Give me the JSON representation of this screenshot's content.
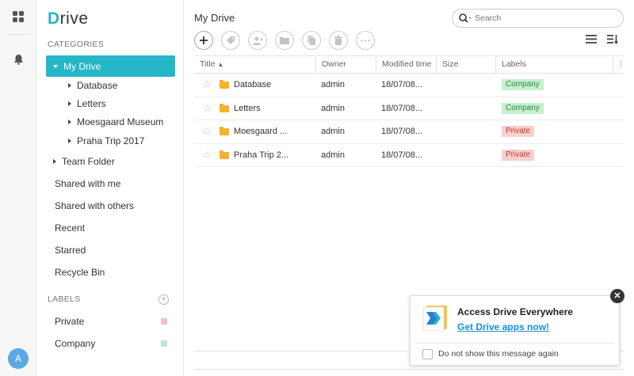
{
  "app": {
    "logo_first": "D",
    "logo_rest": "rive"
  },
  "user": {
    "avatar_initial": "A"
  },
  "sidebar": {
    "categories_title": "CATEGORIES",
    "my_drive": "My Drive",
    "my_drive_children": [
      "Database",
      "Letters",
      "Moesgaard Museum",
      "Praha Trip 2017"
    ],
    "team_folder": "Team Folder",
    "links": [
      "Shared with me",
      "Shared with others",
      "Recent",
      "Starred",
      "Recycle Bin"
    ],
    "labels_title": "LABELS",
    "labels": [
      {
        "name": "Private",
        "color": "#f8c2c2"
      },
      {
        "name": "Company",
        "color": "#bde8c6"
      }
    ]
  },
  "main": {
    "title": "My Drive",
    "search_placeholder": "Search",
    "columns": [
      "Title",
      "Owner",
      "Modified time",
      "Size",
      "Labels"
    ],
    "rows": [
      {
        "title": "Database",
        "owner": "admin",
        "modified": "18/07/08...",
        "size": "",
        "label": "Company"
      },
      {
        "title": "Letters",
        "owner": "admin",
        "modified": "18/07/08...",
        "size": "",
        "label": "Company"
      },
      {
        "title": "Moesgaard ...",
        "owner": "admin",
        "modified": "18/07/08...",
        "size": "",
        "label": "Private"
      },
      {
        "title": "Praha Trip 2...",
        "owner": "admin",
        "modified": "18/07/08...",
        "size": "",
        "label": "Private"
      }
    ]
  },
  "colors": {
    "accent": "#25b7c8",
    "company_bg": "#c6efcf",
    "company_fg": "#2d8a43",
    "private_bg": "#f9cfcf",
    "private_fg": "#c0392b"
  },
  "popup": {
    "title": "Access Drive Everywhere",
    "link": "Get Drive apps now!",
    "checkbox_label": "Do not show this message again"
  }
}
